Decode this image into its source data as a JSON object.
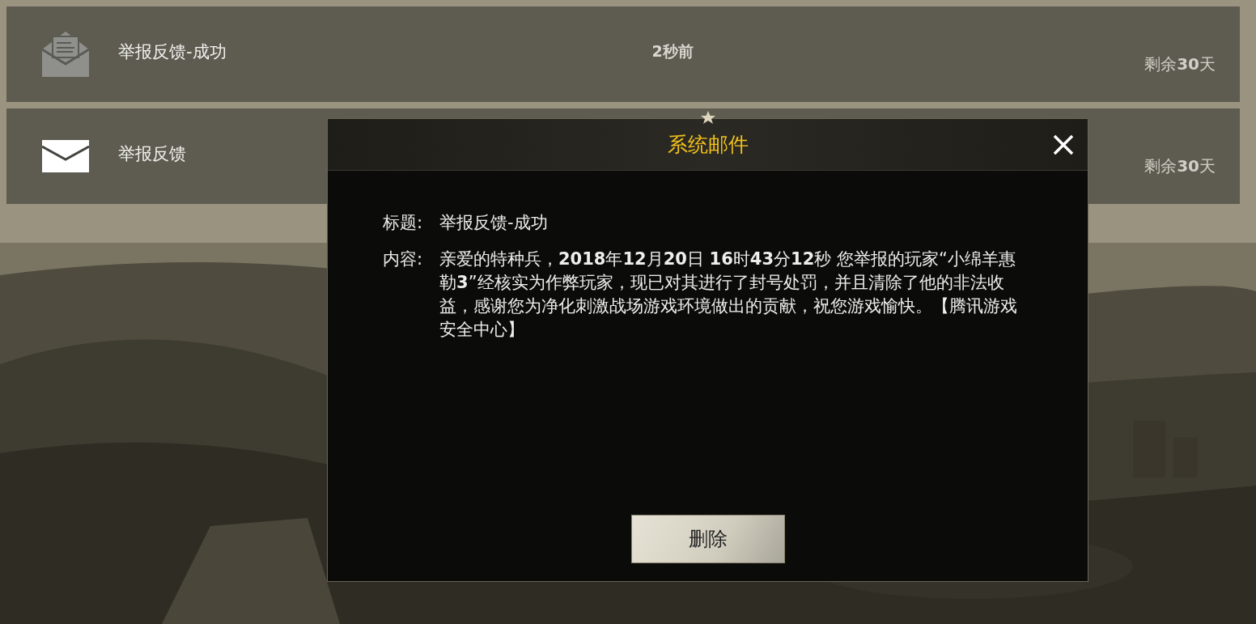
{
  "mail_list": [
    {
      "read": true,
      "title": "举报反馈-成功",
      "time": "2秒前",
      "remaining": "剩余**30**天"
    },
    {
      "read": false,
      "title": "举报反馈",
      "remaining": "剩余**30**天"
    }
  ],
  "dialog": {
    "title": "系统邮件",
    "subject_label": "标题:",
    "subject": "举报反馈-成功",
    "content_label": "内容:",
    "content": "亲爱的特种兵，**2018**年**12**月**20**日 **16**时**43**分**12**秒 您举报的玩家“小绵羊惠勒**3**”经核实为作弊玩家，现已对其进行了封号处罚，并且清除了他的非法收益，感谢您为净化刺激战场游戏环境做出的贡献，祝您游戏愉快。【腾讯游戏安全中心】",
    "delete_button": "删除"
  }
}
